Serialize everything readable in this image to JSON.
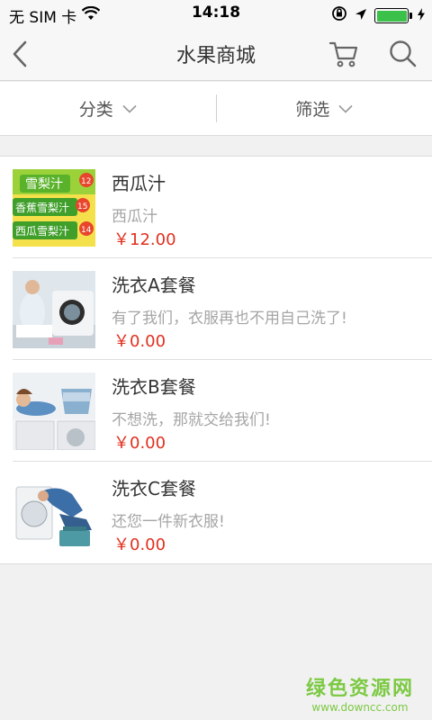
{
  "status_bar": {
    "carrier": "无 SIM 卡",
    "time": "14:18",
    "battery_level": 1.0,
    "icons": [
      "wifi-icon",
      "rotation-lock-icon",
      "location-arrow-icon",
      "battery-icon",
      "charging-bolt-icon"
    ]
  },
  "nav": {
    "title": "水果商城",
    "back_icon": "chevron-left-icon",
    "cart_icon": "cart-icon",
    "search_icon": "search-icon"
  },
  "filters": [
    {
      "label": "分类",
      "icon": "chevron-down-icon"
    },
    {
      "label": "筛选",
      "icon": "chevron-down-icon"
    }
  ],
  "products": [
    {
      "title": "西瓜汁",
      "desc": "西瓜汁",
      "price": "￥12.00"
    },
    {
      "title": "洗衣A套餐",
      "desc": "有了我们，衣服再也不用自己洗了!",
      "price": "￥0.00"
    },
    {
      "title": "洗衣B套餐",
      "desc": "不想洗，那就交给我们!",
      "price": "￥0.00"
    },
    {
      "title": "洗衣C套餐",
      "desc": "还您一件新衣服!",
      "price": "￥0.00"
    }
  ],
  "thumb_texts": {
    "juice_1": "雪梨汁",
    "juice_2": "香蕉雪梨汁",
    "juice_3": "西瓜雪梨汁",
    "price_a": "12",
    "price_b": "15",
    "price_c": "14"
  },
  "watermark": {
    "main": "绿色资源网",
    "url": "www.downcc.com"
  },
  "colors": {
    "price": "#e0301e",
    "desc": "#a5a5a5",
    "watermark": "#7cc943",
    "battery": "#3bc14a"
  }
}
